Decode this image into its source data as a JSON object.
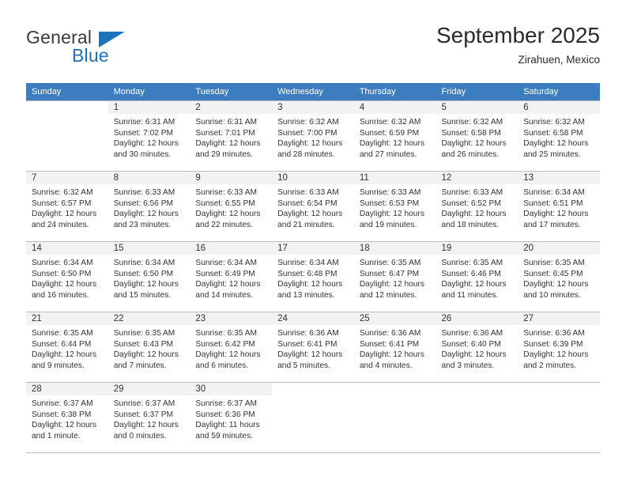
{
  "brand": {
    "name_part1": "General",
    "name_part2": "Blue",
    "logo_icon": "blue-triangle-logo"
  },
  "header": {
    "title": "September 2025",
    "location": "Zirahuen, Mexico"
  },
  "colors": {
    "header_row_bg": "#3b7dbf",
    "brand_blue": "#1b74bb",
    "daynum_band_bg": "#f2f2f2",
    "grid_border": "#bdbdbd"
  },
  "weekday_headers": [
    "Sunday",
    "Monday",
    "Tuesday",
    "Wednesday",
    "Thursday",
    "Friday",
    "Saturday"
  ],
  "weeks": [
    [
      {
        "empty": true
      },
      {
        "day": "1",
        "sunrise": "Sunrise: 6:31 AM",
        "sunset": "Sunset: 7:02 PM",
        "daylight_line1": "Daylight: 12 hours",
        "daylight_line2": "and 30 minutes."
      },
      {
        "day": "2",
        "sunrise": "Sunrise: 6:31 AM",
        "sunset": "Sunset: 7:01 PM",
        "daylight_line1": "Daylight: 12 hours",
        "daylight_line2": "and 29 minutes."
      },
      {
        "day": "3",
        "sunrise": "Sunrise: 6:32 AM",
        "sunset": "Sunset: 7:00 PM",
        "daylight_line1": "Daylight: 12 hours",
        "daylight_line2": "and 28 minutes."
      },
      {
        "day": "4",
        "sunrise": "Sunrise: 6:32 AM",
        "sunset": "Sunset: 6:59 PM",
        "daylight_line1": "Daylight: 12 hours",
        "daylight_line2": "and 27 minutes."
      },
      {
        "day": "5",
        "sunrise": "Sunrise: 6:32 AM",
        "sunset": "Sunset: 6:58 PM",
        "daylight_line1": "Daylight: 12 hours",
        "daylight_line2": "and 26 minutes."
      },
      {
        "day": "6",
        "sunrise": "Sunrise: 6:32 AM",
        "sunset": "Sunset: 6:58 PM",
        "daylight_line1": "Daylight: 12 hours",
        "daylight_line2": "and 25 minutes."
      }
    ],
    [
      {
        "day": "7",
        "sunrise": "Sunrise: 6:32 AM",
        "sunset": "Sunset: 6:57 PM",
        "daylight_line1": "Daylight: 12 hours",
        "daylight_line2": "and 24 minutes."
      },
      {
        "day": "8",
        "sunrise": "Sunrise: 6:33 AM",
        "sunset": "Sunset: 6:56 PM",
        "daylight_line1": "Daylight: 12 hours",
        "daylight_line2": "and 23 minutes."
      },
      {
        "day": "9",
        "sunrise": "Sunrise: 6:33 AM",
        "sunset": "Sunset: 6:55 PM",
        "daylight_line1": "Daylight: 12 hours",
        "daylight_line2": "and 22 minutes."
      },
      {
        "day": "10",
        "sunrise": "Sunrise: 6:33 AM",
        "sunset": "Sunset: 6:54 PM",
        "daylight_line1": "Daylight: 12 hours",
        "daylight_line2": "and 21 minutes."
      },
      {
        "day": "11",
        "sunrise": "Sunrise: 6:33 AM",
        "sunset": "Sunset: 6:53 PM",
        "daylight_line1": "Daylight: 12 hours",
        "daylight_line2": "and 19 minutes."
      },
      {
        "day": "12",
        "sunrise": "Sunrise: 6:33 AM",
        "sunset": "Sunset: 6:52 PM",
        "daylight_line1": "Daylight: 12 hours",
        "daylight_line2": "and 18 minutes."
      },
      {
        "day": "13",
        "sunrise": "Sunrise: 6:34 AM",
        "sunset": "Sunset: 6:51 PM",
        "daylight_line1": "Daylight: 12 hours",
        "daylight_line2": "and 17 minutes."
      }
    ],
    [
      {
        "day": "14",
        "sunrise": "Sunrise: 6:34 AM",
        "sunset": "Sunset: 6:50 PM",
        "daylight_line1": "Daylight: 12 hours",
        "daylight_line2": "and 16 minutes."
      },
      {
        "day": "15",
        "sunrise": "Sunrise: 6:34 AM",
        "sunset": "Sunset: 6:50 PM",
        "daylight_line1": "Daylight: 12 hours",
        "daylight_line2": "and 15 minutes."
      },
      {
        "day": "16",
        "sunrise": "Sunrise: 6:34 AM",
        "sunset": "Sunset: 6:49 PM",
        "daylight_line1": "Daylight: 12 hours",
        "daylight_line2": "and 14 minutes."
      },
      {
        "day": "17",
        "sunrise": "Sunrise: 6:34 AM",
        "sunset": "Sunset: 6:48 PM",
        "daylight_line1": "Daylight: 12 hours",
        "daylight_line2": "and 13 minutes."
      },
      {
        "day": "18",
        "sunrise": "Sunrise: 6:35 AM",
        "sunset": "Sunset: 6:47 PM",
        "daylight_line1": "Daylight: 12 hours",
        "daylight_line2": "and 12 minutes."
      },
      {
        "day": "19",
        "sunrise": "Sunrise: 6:35 AM",
        "sunset": "Sunset: 6:46 PM",
        "daylight_line1": "Daylight: 12 hours",
        "daylight_line2": "and 11 minutes."
      },
      {
        "day": "20",
        "sunrise": "Sunrise: 6:35 AM",
        "sunset": "Sunset: 6:45 PM",
        "daylight_line1": "Daylight: 12 hours",
        "daylight_line2": "and 10 minutes."
      }
    ],
    [
      {
        "day": "21",
        "sunrise": "Sunrise: 6:35 AM",
        "sunset": "Sunset: 6:44 PM",
        "daylight_line1": "Daylight: 12 hours",
        "daylight_line2": "and 9 minutes."
      },
      {
        "day": "22",
        "sunrise": "Sunrise: 6:35 AM",
        "sunset": "Sunset: 6:43 PM",
        "daylight_line1": "Daylight: 12 hours",
        "daylight_line2": "and 7 minutes."
      },
      {
        "day": "23",
        "sunrise": "Sunrise: 6:35 AM",
        "sunset": "Sunset: 6:42 PM",
        "daylight_line1": "Daylight: 12 hours",
        "daylight_line2": "and 6 minutes."
      },
      {
        "day": "24",
        "sunrise": "Sunrise: 6:36 AM",
        "sunset": "Sunset: 6:41 PM",
        "daylight_line1": "Daylight: 12 hours",
        "daylight_line2": "and 5 minutes."
      },
      {
        "day": "25",
        "sunrise": "Sunrise: 6:36 AM",
        "sunset": "Sunset: 6:41 PM",
        "daylight_line1": "Daylight: 12 hours",
        "daylight_line2": "and 4 minutes."
      },
      {
        "day": "26",
        "sunrise": "Sunrise: 6:36 AM",
        "sunset": "Sunset: 6:40 PM",
        "daylight_line1": "Daylight: 12 hours",
        "daylight_line2": "and 3 minutes."
      },
      {
        "day": "27",
        "sunrise": "Sunrise: 6:36 AM",
        "sunset": "Sunset: 6:39 PM",
        "daylight_line1": "Daylight: 12 hours",
        "daylight_line2": "and 2 minutes."
      }
    ],
    [
      {
        "day": "28",
        "sunrise": "Sunrise: 6:37 AM",
        "sunset": "Sunset: 6:38 PM",
        "daylight_line1": "Daylight: 12 hours",
        "daylight_line2": "and 1 minute."
      },
      {
        "day": "29",
        "sunrise": "Sunrise: 6:37 AM",
        "sunset": "Sunset: 6:37 PM",
        "daylight_line1": "Daylight: 12 hours",
        "daylight_line2": "and 0 minutes."
      },
      {
        "day": "30",
        "sunrise": "Sunrise: 6:37 AM",
        "sunset": "Sunset: 6:36 PM",
        "daylight_line1": "Daylight: 11 hours",
        "daylight_line2": "and 59 minutes."
      },
      {
        "empty": true
      },
      {
        "empty": true
      },
      {
        "empty": true
      },
      {
        "empty": true
      }
    ]
  ]
}
